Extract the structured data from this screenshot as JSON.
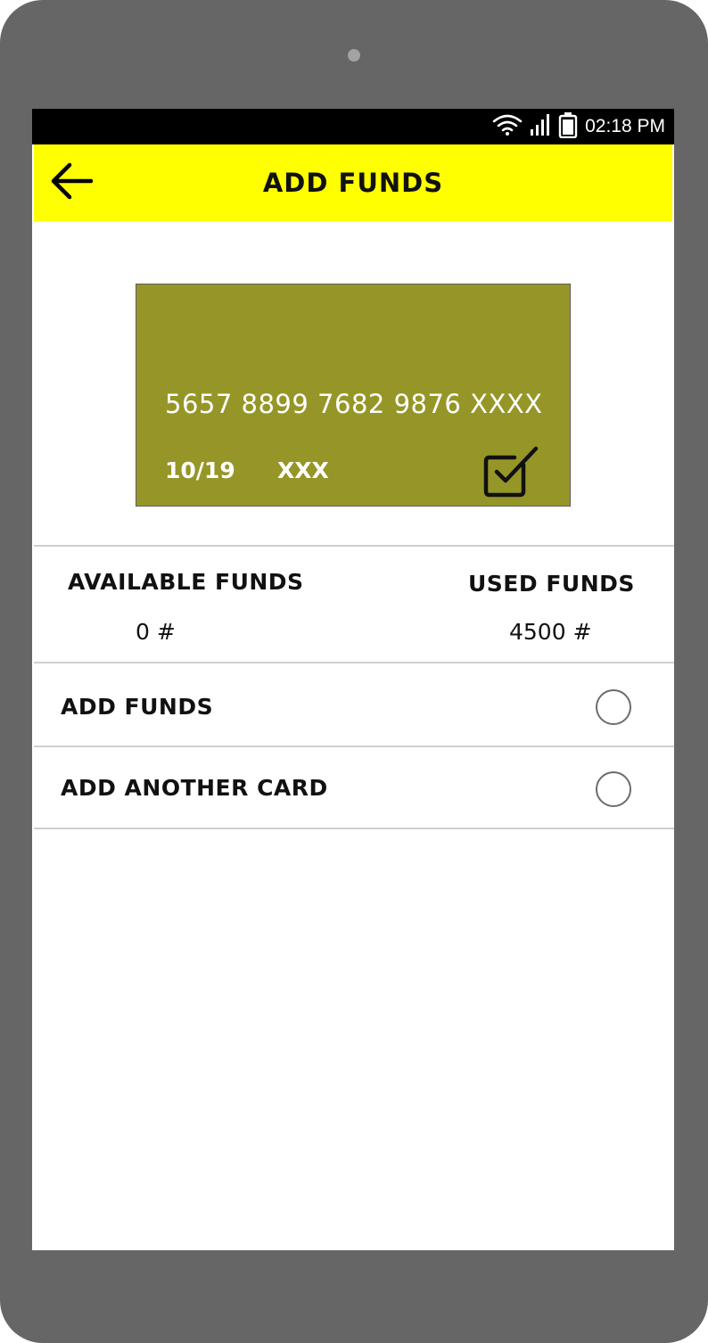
{
  "status_bar": {
    "time": "02:18 PM",
    "icons": [
      "wifi-icon",
      "signal-icon",
      "battery-icon"
    ]
  },
  "app_bar": {
    "title": "ADD FUNDS",
    "back_icon": "back-arrow-icon",
    "background": "#ffff00"
  },
  "card": {
    "number": "5657 8899 7682 9876 XXXX",
    "expiry": "10/19",
    "cvv": "XXX",
    "selected_icon": "checkbox-checked-icon",
    "color": "#969628"
  },
  "funds": {
    "available_label": "AVAILABLE FUNDS",
    "available_value": "0 #",
    "used_label": "USED FUNDS",
    "used_value": "4500 #"
  },
  "options": [
    {
      "label": "ADD FUNDS",
      "selected": false
    },
    {
      "label": "ADD ANOTHER CARD",
      "selected": false
    }
  ],
  "colors": {
    "device": "#666666",
    "status_bar": "#000000",
    "divider": "#cfcfcf"
  }
}
